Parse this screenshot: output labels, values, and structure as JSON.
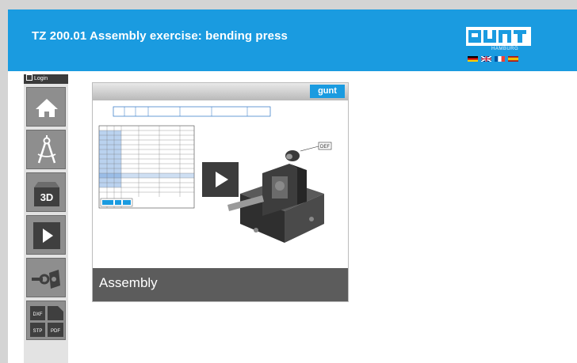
{
  "header": {
    "title": "TZ 200.01 Assembly exercise: bending press",
    "logo": "gunt",
    "logo_sub": "HAMBURG",
    "languages": [
      "de",
      "en",
      "fr",
      "es"
    ]
  },
  "sidebar": {
    "login_label": "Login",
    "items": [
      {
        "name": "home",
        "icon": "home-icon"
      },
      {
        "name": "drawing",
        "icon": "compass-icon"
      },
      {
        "name": "3d",
        "icon": "3d-icon",
        "label": "3D"
      },
      {
        "name": "video",
        "icon": "play-icon"
      },
      {
        "name": "assembly",
        "icon": "key-lock-icon"
      },
      {
        "name": "downloads",
        "icon": "files-icon",
        "labels": [
          "DXF",
          "STP",
          "PDF"
        ]
      }
    ]
  },
  "video": {
    "caption": "Assembly",
    "thumb_logo": "gunt",
    "callout": "DEF"
  },
  "colors": {
    "header_bg": "#1a9be0",
    "sidebar_button": "#8e8e8e",
    "caption_bar": "#5c5c5c"
  }
}
